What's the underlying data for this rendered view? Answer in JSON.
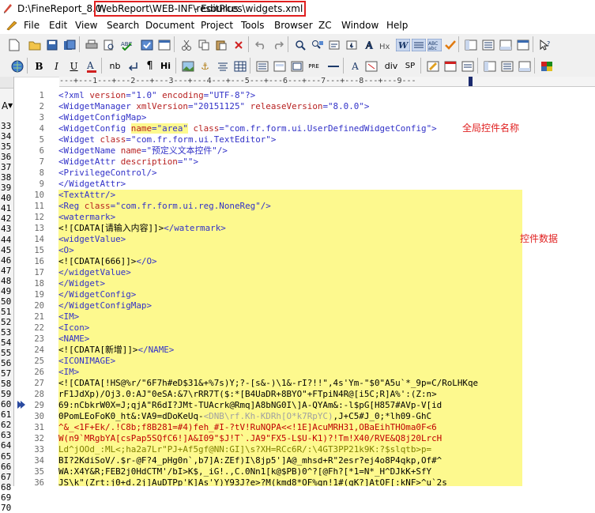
{
  "window": {
    "path_prefix": "D:\\FineReport_8.0\\",
    "highlighted_path": "WebReport\\WEB-INF\\resources\\widgets.xml",
    "app_suffix": "- EditPlus"
  },
  "menu": [
    "File",
    "Edit",
    "View",
    "Search",
    "Document",
    "Project",
    "Tools",
    "Browser",
    "ZC",
    "Window",
    "Help"
  ],
  "toolbar1": [
    "new-file-icon",
    "open-folder-icon",
    "save-icon",
    "save-all-icon",
    "print-icon",
    "print-preview-icon",
    "spell-check-icon",
    "cut-icon",
    "copy-icon",
    "paste-icon",
    "delete-icon",
    "undo-icon",
    "redo-icon",
    "find-icon",
    "find-replace-icon",
    "find-next-icon",
    "goto-line-icon",
    "font-icon",
    "hex-icon",
    "word-wrap-icon",
    "line-number-icon",
    "abc-icon",
    "check-icon",
    "toggle-panel-icon",
    "directory-icon",
    "window-icon",
    "output-icon",
    "help-cursor-icon"
  ],
  "toolbar2": [
    "browser-globe-icon",
    "bold-icon",
    "italic-icon",
    "underline-icon",
    "font-color-icon",
    "nbsp-icon",
    "br-icon",
    "para-icon",
    "hi-icon",
    "image-icon",
    "anchor-icon",
    "center-icon",
    "table-icon",
    "list-icon",
    "pre-icon",
    "hr-icon",
    "style-icon",
    "div-icon",
    "sp-icon",
    "preview-icon",
    "calendar-icon",
    "preview2-icon",
    "color-picker-icon"
  ],
  "toolbar2_text": {
    "nb": "nb",
    "hi": "Hi",
    "pre": "PRE",
    "div": "div",
    "sp": "SP"
  },
  "left_panel": {
    "font_label": "A",
    "line_numbers": [
      "33",
      "34",
      "35",
      "36",
      "37",
      "38",
      "39",
      "40",
      "41",
      "42",
      "43",
      "44",
      "45",
      "46",
      "47",
      "48",
      "49",
      "50",
      "51",
      "52",
      "53",
      "54",
      "55",
      "56",
      "57",
      "58",
      "59",
      "60",
      "61",
      "62",
      "63",
      "64",
      "65",
      "66",
      "67",
      "68",
      "69",
      "70"
    ]
  },
  "ruler_text": "---+---1---+---2---+---3---+---4---+---5---+---6---+---7---+---8---+---9---",
  "gutter": [
    "1",
    "2",
    "3",
    "4",
    "5",
    "6",
    "7",
    "8",
    "9",
    "10",
    "11",
    "12",
    "13",
    "14",
    "15",
    "16",
    "17",
    "18",
    "19",
    "20",
    "21",
    "22",
    "23",
    "24",
    "25",
    "26",
    "27",
    "28",
    "29",
    "30",
    "31",
    "32",
    "33",
    "34",
    "35",
    "36"
  ],
  "code": {
    "l1": {
      "tag_open": "<?xml ",
      "a1": "version",
      "eq1": "=",
      "v1": "\"1.0\"",
      "sp": " ",
      "a2": "encoding",
      "eq2": "=",
      "v2": "\"UTF-8\"",
      "tag_close": "?>"
    },
    "l2": {
      "tag_open": "<WidgetManager ",
      "a1": "xmlVersion",
      "eq1": "=",
      "v1": "\"20151125\"",
      "sp": " ",
      "a2": "releaseVersion",
      "eq2": "=",
      "v2": "\"8.0.0\"",
      "tag_close": ">"
    },
    "l3": "<WidgetConfigMap>",
    "l4": {
      "tag_open": "<WidgetConfig ",
      "a1": "name",
      "eq1": "=",
      "v1": "\"area\"",
      "sp": " ",
      "a2": "class",
      "eq2": "=",
      "v2": "\"com.fr.form.ui.UserDefinedWidgetConfig\"",
      "tag_close": ">"
    },
    "l5": {
      "tag_open": "<Widget ",
      "a1": "class",
      "eq1": "=",
      "v1": "\"com.fr.form.ui.TextEditor\"",
      "tag_close": ">"
    },
    "l6": {
      "tag_open": "<WidgetName ",
      "a1": "name",
      "eq1": "=",
      "v1": "\"预定义文本控件\"",
      "tag_close": "/>"
    },
    "l7": {
      "tag_open": "<WidgetAttr ",
      "a1": "description",
      "eq1": "=",
      "v1": "\"\"",
      "tag_close": ">"
    },
    "l8": "<PrivilegeControl/>",
    "l9": "</WidgetAttr>",
    "l10": "<TextAttr/>",
    "l11": {
      "tag_open": "<Reg ",
      "a1": "class",
      "eq1": "=",
      "v1": "\"com.fr.form.ui.reg.NoneReg\"",
      "tag_close": "/>"
    },
    "l12": "<watermark>",
    "l13": {
      "cdata": "<![CDATA[请输入内容]]>",
      "end": "</watermark>"
    },
    "l14": "<widgetValue>",
    "l15": "<O>",
    "l16": {
      "cdata": "<![CDATA[666]]>",
      "end": "</O>"
    },
    "l17": "</widgetValue>",
    "l18": "</Widget>",
    "l19": "</WidgetConfig>",
    "l20": "</WidgetConfigMap>",
    "l21": "<IM>",
    "l22": "<Icon>",
    "l23": "<NAME>",
    "l24": {
      "cdata": "<![CDATA[新增]]>",
      "end": "</NAME>"
    },
    "l25": "<ICONIMAGE>",
    "l26": "<IM>",
    "l27": "<![CDATA[!HS@%r/\"6F7h#eD$31&+%7s)Y;?-[s&-)\\1&-rI?!!\",4s'Ym-\"$0\"A5u`*_9p=C/RoLHKqe",
    "l28": "rF1JdXp)/Oj3.0:AJ\"0eSA:&7\\rRR7T($:*[B4UaDR+8BYO\"+FTpiN4R@[i5C;R]A%':(Z:n>",
    "l29": "69:nCbkrW0X=J;qjA\"R6dI?JMt-TUAcrk@Rmq]A8bNG0I\\]A-QYAm&:-l$pG[H857#AVp-V[id",
    "l30": {
      "a": "0PomLEoFoK0_ht&:VA9=dDoKeUq-",
      "b": "<DNB\\rf.Kh-KDRh[O*k7RpYC)",
      "c": ",J+C5#J_0;*lh09-GhC"
    },
    "l31": "^&_<1F+Ek/.!C8b;f8B281=#4)feh_#I-?tV!RuNQPA<<!1E]AcuMRH31,OBaEihTHOma0F<6",
    "l32": "W(n9`MRgbYA[csPap5SQfC6!]A&I09\"$J!T`.JA9\"FX5-L$U-K1)?!Tm!X40/RVE&Q8j20LrcH",
    "l33": "Ld^jOOd_:ML<;ha2a7Lr\"PJ+Af5gf@NN:GI]\\s?XH=RCc6R/:\\4GT3PP21k9K:?$slqtb>p=",
    "l34": "BI?2KdiSoV/.$r-@F?4_pHg0n`,b7]A:ZEf)I\\8jp5']A@_mhsd+R\"2esr?ej4o8P4qkp,Of#^",
    "l35": "WA:X4Y&R;FEB2j0HdCTM'/bI>K$,_iG!.,C.0Nn1[k@$PB)0^?[@Fh?[*1=N*_H^DJkK+SfY",
    "l36": "JS\\k\"(Zrt:j0+d.2j]AuDTPp'K]As'Y)Y93J?e>?M(kmd8*OF%gn!1#(gK?]AtOF[:kNF>^u`2s"
  },
  "annotations": {
    "global_name": "全局控件名称",
    "widget_data": "控件数据"
  },
  "colors": {
    "highlight": "#fdf98e",
    "annotation": "#e02020",
    "tag": "#3232c8",
    "attr": "#b82222"
  }
}
